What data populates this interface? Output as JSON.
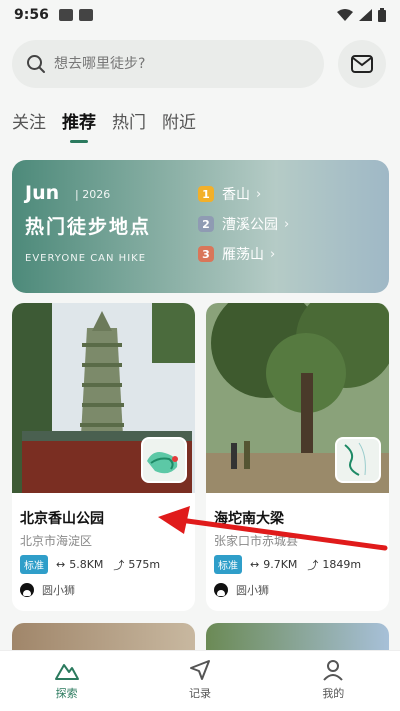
{
  "status": {
    "time": "9:56"
  },
  "search": {
    "placeholder": "想去哪里徒步?"
  },
  "tabs": [
    {
      "label": "关注",
      "active": false
    },
    {
      "label": "推荐",
      "active": true
    },
    {
      "label": "热门",
      "active": false
    },
    {
      "label": "附近",
      "active": false
    }
  ],
  "banner": {
    "month": "Jun",
    "year": "| 2026",
    "headline": "热门徒步地点",
    "subtitle": "EVERYONE CAN HIKE",
    "ranks": [
      {
        "num": "1",
        "name": "香山",
        "color": "#f2b02a"
      },
      {
        "num": "2",
        "name": "漕溪公园",
        "color": "#8f9bb3"
      },
      {
        "num": "3",
        "name": "雁荡山",
        "color": "#d9765a"
      }
    ]
  },
  "cards": [
    {
      "name": "北京香山公园",
      "location": "北京市海淀区",
      "badge": "标准",
      "distance": "5.8KM",
      "elevation": "575m",
      "author": "圆小狮"
    },
    {
      "name": "海坨南大梁",
      "location": "张家口市赤城县",
      "badge": "标准",
      "distance": "9.7KM",
      "elevation": "1849m",
      "author": "圆小狮"
    }
  ],
  "nav": [
    {
      "label": "探索",
      "active": true
    },
    {
      "label": "记录",
      "active": false
    },
    {
      "label": "我的",
      "active": false
    }
  ],
  "colors": {
    "accent": "#2b7a5e",
    "badge": "#2f9ec9",
    "arrow": "#e01b1b"
  }
}
